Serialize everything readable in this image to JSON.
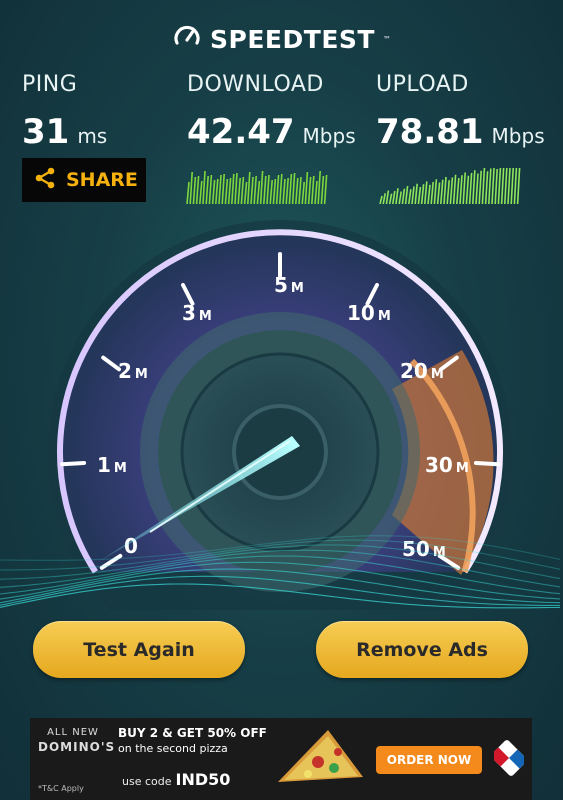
{
  "header": {
    "title": "SPEEDTEST",
    "trademark": "™",
    "icon": "speedometer-icon"
  },
  "metrics": {
    "ping": {
      "label": "PING",
      "value": "31",
      "unit": "ms"
    },
    "download": {
      "label": "DOWNLOAD",
      "value": "42.47",
      "unit": "Mbps"
    },
    "upload": {
      "label": "UPLOAD",
      "value": "78.81",
      "unit": "Mbps"
    }
  },
  "share": {
    "label": "SHARE",
    "icon": "share-icon"
  },
  "gauge": {
    "scale_labels": [
      {
        "num": "0",
        "unit": ""
      },
      {
        "num": "1",
        "unit": "M"
      },
      {
        "num": "2",
        "unit": "M"
      },
      {
        "num": "3",
        "unit": "M"
      },
      {
        "num": "5",
        "unit": "M"
      },
      {
        "num": "10",
        "unit": "M"
      },
      {
        "num": "20",
        "unit": "M"
      },
      {
        "num": "30",
        "unit": "M"
      },
      {
        "num": "50",
        "unit": "M"
      }
    ]
  },
  "buttons": {
    "test_again": "Test Again",
    "remove_ads": "Remove Ads"
  },
  "ad": {
    "brand_top": "ALL NEW",
    "brand": "DOMINO'S",
    "offer_line1": "BUY 2 & GET 50% OFF",
    "offer_line2": "on the second pizza",
    "code_label": "use code",
    "code": "IND50",
    "tbc": "*T&C Apply",
    "cta": "ORDER NOW"
  },
  "colors": {
    "accent_gold": "#f2b51a",
    "upload_green": "#8ee65a",
    "download_green": "#7dd83c",
    "gauge_purple": "#b58cff",
    "gauge_orange": "#e8893a"
  }
}
